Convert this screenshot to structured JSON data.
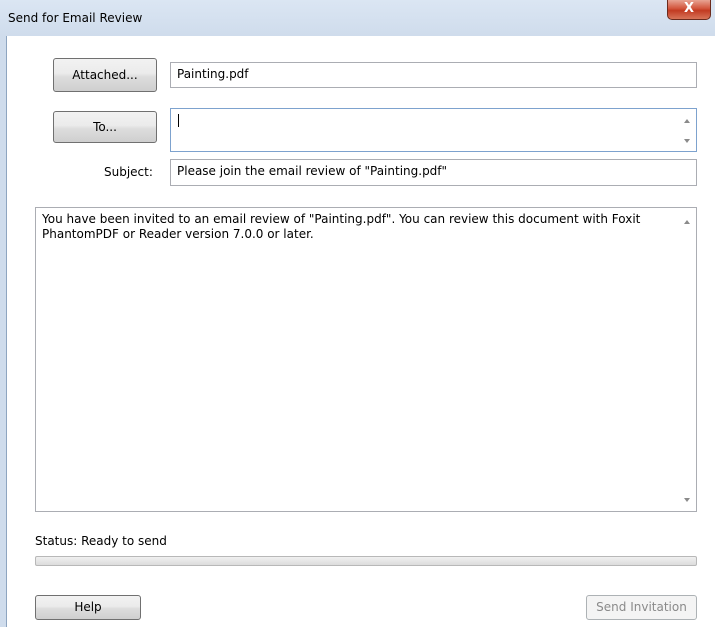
{
  "window": {
    "title": "Send for Email Review",
    "close_label": "X"
  },
  "form": {
    "attached_button": "Attached...",
    "attached_value": "Painting.pdf",
    "to_button": "To...",
    "to_value": "",
    "subject_label": "Subject:",
    "subject_value": "Please join the email review of \"Painting.pdf\"",
    "message": "You have been invited to an email review of \"Painting.pdf\". You can review this document with Foxit PhantomPDF or Reader version 7.0.0 or later."
  },
  "status": {
    "text": "Status: Ready to send",
    "progress_fraction": 0
  },
  "footer": {
    "help_button": "Help",
    "send_button": "Send Invitation"
  }
}
